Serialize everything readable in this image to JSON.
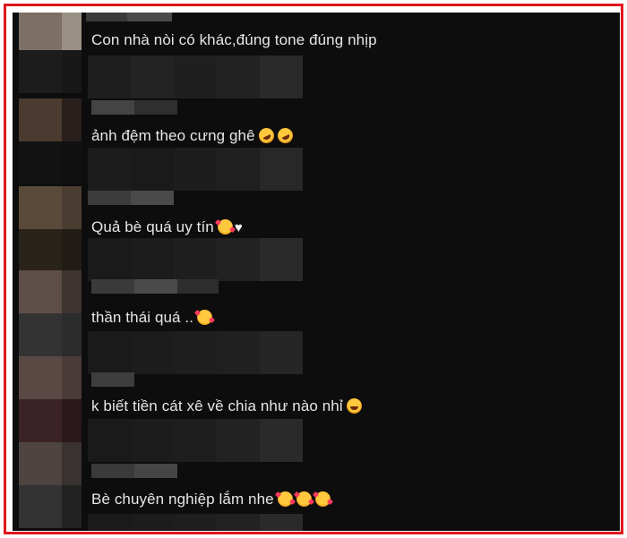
{
  "comments": [
    {
      "text": "Con nhà nòi có khác,đúng tone đúng nhịp",
      "emojis": [],
      "suffix": ""
    },
    {
      "text": "ảnh đệm theo cưng ghê",
      "emojis": [
        "rofl",
        "rofl"
      ],
      "suffix": ""
    },
    {
      "text": "Quả bè quá uy tín",
      "emojis": [
        "hearts"
      ],
      "suffix": "♥"
    },
    {
      "text": "thần thái quá ..",
      "emojis": [
        "hearts"
      ],
      "suffix": ""
    },
    {
      "text": "k biết tiền cát xê về chia như nào nhỉ",
      "emojis": [
        "joy"
      ],
      "suffix": ""
    },
    {
      "text": "Bè chuyên nghiệp lắm nhe",
      "emojis": [
        "hearts",
        "hearts",
        "hearts"
      ],
      "suffix": ""
    }
  ],
  "colors": {
    "frame_border": "#e0161e",
    "background": "#0d0d0d",
    "text": "#e6e6e6"
  }
}
